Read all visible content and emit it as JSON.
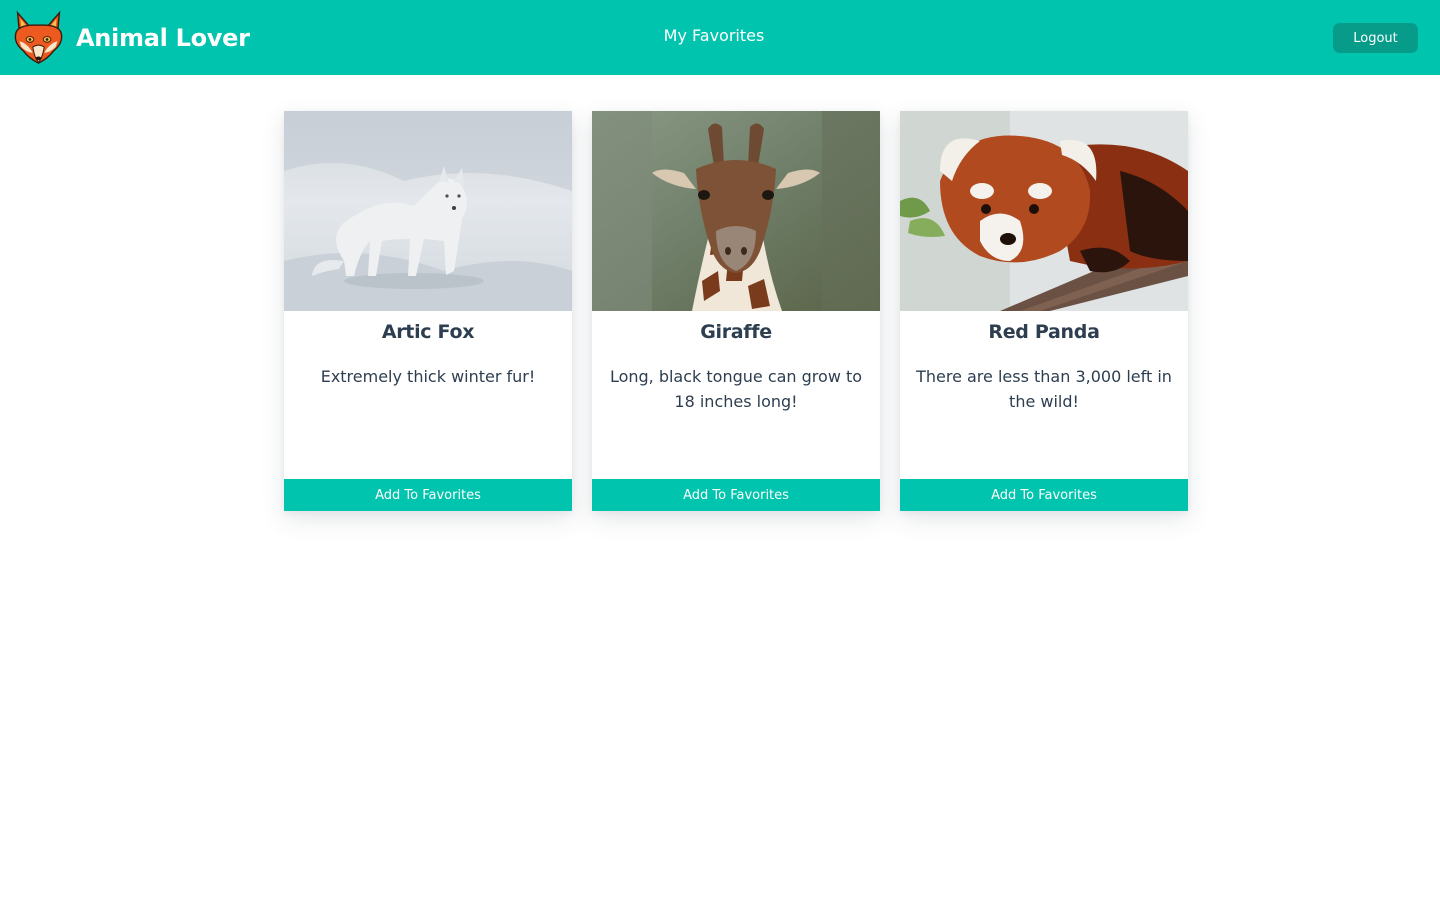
{
  "header": {
    "brand_name": "Animal Lover",
    "logo_icon": "fox-icon",
    "nav_favorites": "My Favorites",
    "logout_label": "Logout"
  },
  "cards": [
    {
      "title": "Artic Fox",
      "description": "Extremely thick winter fur!",
      "button_label": "Add To Favorites"
    },
    {
      "title": "Giraffe",
      "description": "Long, black tongue can grow to 18 inches long!",
      "button_label": "Add To Favorites"
    },
    {
      "title": "Red Panda",
      "description": "There are less than 3,000 left in the wild!",
      "button_label": "Add To Favorites"
    }
  ],
  "colors": {
    "brand": "#00c4ad",
    "logout_button": "#079b8a",
    "text": "#2d3e50",
    "background": "#ffffff"
  }
}
